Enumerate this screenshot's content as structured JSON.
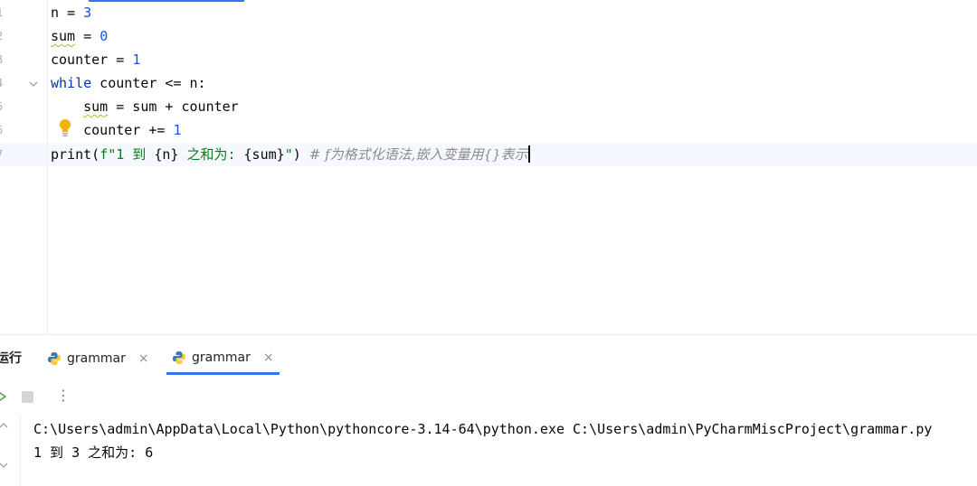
{
  "editor": {
    "line_numbers": [
      "1",
      "2",
      "3",
      "4",
      "5",
      "6",
      "7"
    ],
    "lines": [
      {
        "tokens": [
          {
            "t": "n = ",
            "c": "fn"
          },
          {
            "t": "3",
            "c": "num"
          }
        ]
      },
      {
        "tokens": [
          {
            "t": "sum",
            "c": "fn squig"
          },
          {
            "t": " = ",
            "c": "fn"
          },
          {
            "t": "0",
            "c": "num"
          }
        ]
      },
      {
        "tokens": [
          {
            "t": "counter = ",
            "c": "fn"
          },
          {
            "t": "1",
            "c": "num"
          }
        ]
      },
      {
        "tokens": [
          {
            "t": "while",
            "c": "kw"
          },
          {
            "t": " counter <= n:",
            "c": "fn"
          }
        ]
      },
      {
        "tokens": [
          {
            "t": "    ",
            "c": "fn"
          },
          {
            "t": "sum",
            "c": "fn squig"
          },
          {
            "t": " = sum + counter",
            "c": "fn"
          }
        ]
      },
      {
        "tokens": [
          {
            "t": "    counter += ",
            "c": "fn"
          },
          {
            "t": "1",
            "c": "num"
          }
        ]
      },
      {
        "tokens": [
          {
            "t": "print",
            "c": "fn"
          },
          {
            "t": "(",
            "c": "fn"
          },
          {
            "t": "f\"1 到 ",
            "c": "str"
          },
          {
            "t": "{n}",
            "c": "fn"
          },
          {
            "t": " 之和为: ",
            "c": "str"
          },
          {
            "t": "{sum}",
            "c": "fn"
          },
          {
            "t": "\"",
            "c": "str"
          },
          {
            "t": ") ",
            "c": "fn"
          },
          {
            "t": "# f为格式化语法,嵌入变量用{}表示",
            "c": "comment"
          }
        ]
      }
    ]
  },
  "run": {
    "title": "运行",
    "tabs": [
      {
        "label": "grammar",
        "close": "×"
      },
      {
        "label": "grammar",
        "close": "×"
      }
    ],
    "more": "⋮",
    "console": [
      "C:\\Users\\admin\\AppData\\Local\\Python\\pythoncore-3.14-64\\python.exe C:\\Users\\admin\\PyCharmMiscProject\\grammar.py",
      "1 到 3 之和为: 6"
    ]
  },
  "colors": {
    "keyword": "#0033b3",
    "number": "#1750eb",
    "string": "#067d17",
    "comment": "#8c8c8c",
    "accent": "#3574f0"
  }
}
